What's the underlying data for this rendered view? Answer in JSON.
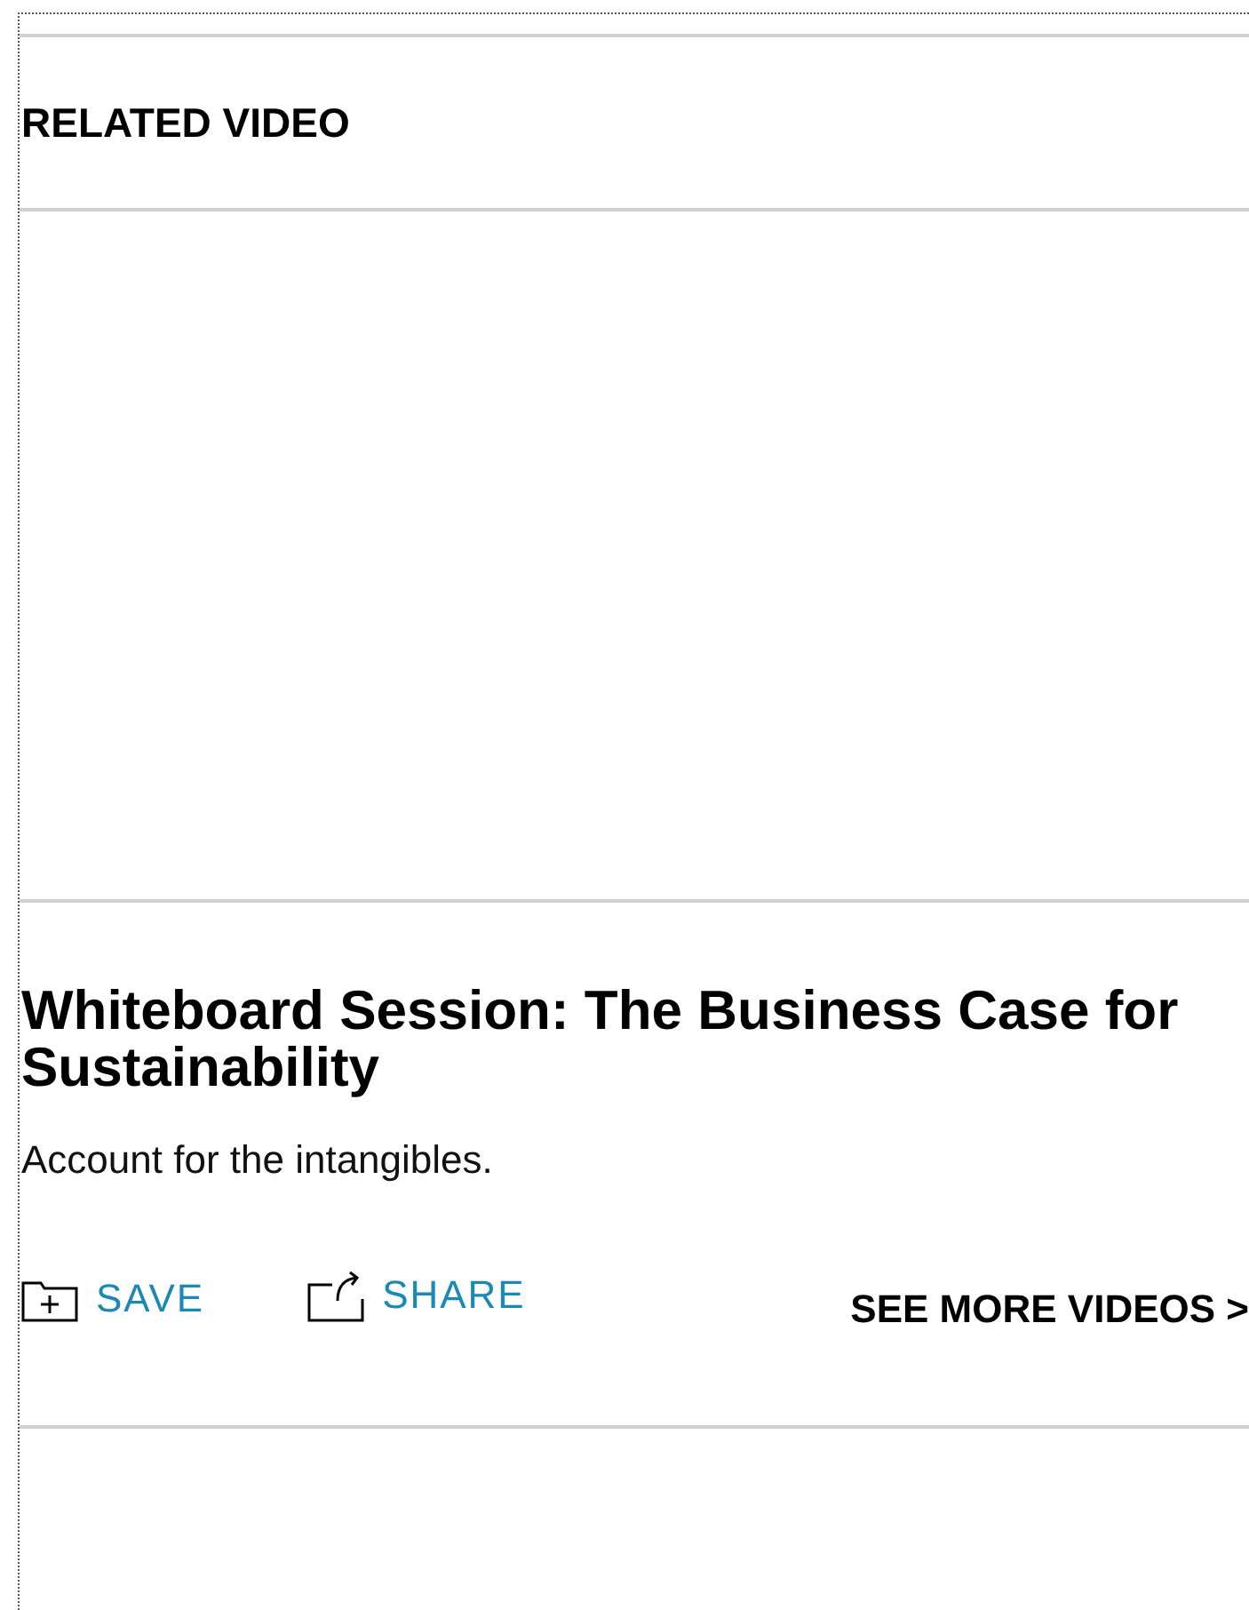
{
  "section": {
    "heading": "RELATED VIDEO"
  },
  "video": {
    "title": "Whiteboard Session: The Business Case for Sustainability",
    "description": "Account for the intangibles."
  },
  "actions": [
    {
      "kind": "save",
      "label": "SAVE"
    },
    {
      "kind": "share",
      "label": "SHARE"
    }
  ],
  "more_link": "SEE MORE VIDEOS >"
}
